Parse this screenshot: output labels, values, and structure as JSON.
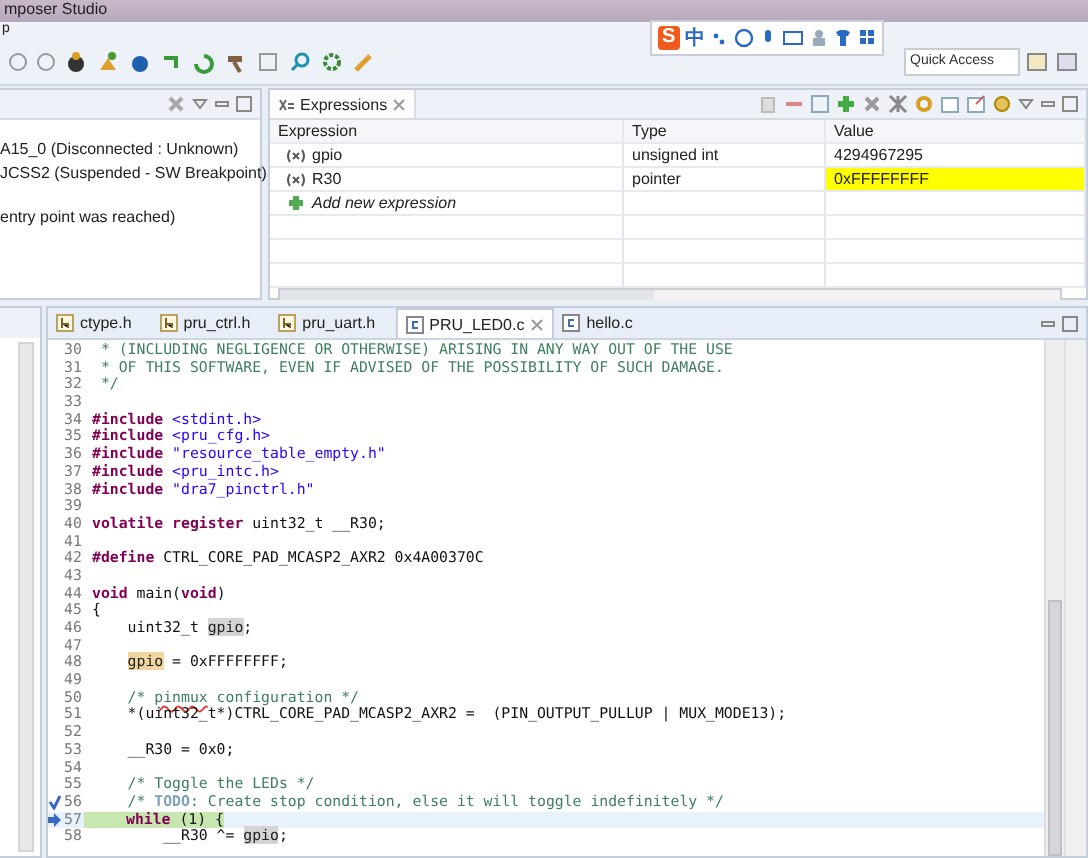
{
  "window": {
    "title": "mposer Studio"
  },
  "menu_bar": {
    "items": [
      "p"
    ]
  },
  "ime_toolbar": {
    "logo": "S",
    "mode": "中"
  },
  "quick_access": {
    "placeholder": "Quick Access"
  },
  "debug_panel": {
    "items": [
      {
        "text": "A15_0 (Disconnected : Unknown)"
      },
      {
        "text": "JCSS2 (Suspended - SW Breakpoint)"
      },
      {
        "text": "entry point was reached)"
      }
    ]
  },
  "expressions": {
    "tab": "Expressions",
    "columns": [
      "Expression",
      "Type",
      "Value"
    ],
    "rows": [
      {
        "name": "gpio",
        "type": "unsigned int",
        "value": "4294967295",
        "changed": false
      },
      {
        "name": "R30",
        "type": "pointer",
        "value": "0xFFFFFFFF",
        "changed": true
      }
    ],
    "add_row": "Add new expression"
  },
  "editor": {
    "tabs": [
      {
        "label": "ctype.h",
        "kind": "header",
        "selected": false
      },
      {
        "label": "pru_ctrl.h",
        "kind": "header",
        "selected": false
      },
      {
        "label": "pru_uart.h",
        "kind": "header",
        "selected": false
      },
      {
        "label": "PRU_LED0.c",
        "kind": "source",
        "selected": true
      },
      {
        "label": "hello.c",
        "kind": "source",
        "selected": false
      }
    ],
    "lines": [
      {
        "num": "30",
        "tokens": [
          {
            "kind": "comment",
            "text": " * (INCLUDING NEGLIGENCE OR OTHERWISE) ARISING IN ANY WAY OUT OF THE USE"
          }
        ]
      },
      {
        "num": "31",
        "tokens": [
          {
            "kind": "comment",
            "text": " * OF THIS SOFTWARE, EVEN IF ADVISED OF THE POSSIBILITY OF SUCH DAMAGE."
          }
        ]
      },
      {
        "num": "32",
        "tokens": [
          {
            "kind": "comment",
            "text": " */"
          }
        ]
      },
      {
        "num": "33"
      },
      {
        "num": "34",
        "tokens": [
          {
            "kind": "keyword",
            "text": "#include"
          },
          {
            "kind": "string",
            "text": " <stdint.h>"
          }
        ]
      },
      {
        "num": "35",
        "tokens": [
          {
            "kind": "keyword",
            "text": "#include"
          },
          {
            "kind": "string",
            "text": " <pru_cfg.h>"
          }
        ]
      },
      {
        "num": "36",
        "tokens": [
          {
            "kind": "keyword",
            "text": "#include"
          },
          {
            "kind": "string",
            "text": " \"resource_table_empty.h\""
          }
        ]
      },
      {
        "num": "37",
        "tokens": [
          {
            "kind": "keyword",
            "text": "#include"
          },
          {
            "kind": "string",
            "text": " <pru_intc.h>"
          }
        ]
      },
      {
        "num": "38",
        "tokens": [
          {
            "kind": "keyword",
            "text": "#include"
          },
          {
            "kind": "string",
            "text": " \"dra7_pinctrl.h\""
          }
        ]
      },
      {
        "num": "39"
      },
      {
        "num": "40",
        "tokens": [
          {
            "kind": "keyword",
            "text": "volatile register"
          },
          {
            "kind": "plain",
            "text": " uint32_t __R30;"
          }
        ]
      },
      {
        "num": "41"
      },
      {
        "num": "42",
        "tokens": [
          {
            "kind": "keyword",
            "text": "#define"
          },
          {
            "kind": "plain",
            "text": " CTRL_CORE_PAD_MCASP2_AXR2 0x4A00370C"
          }
        ]
      },
      {
        "num": "43"
      },
      {
        "num": "44",
        "tokens": [
          {
            "kind": "keyword",
            "text": "void"
          },
          {
            "kind": "plain",
            "text": " main("
          },
          {
            "kind": "keyword",
            "text": "void"
          },
          {
            "kind": "plain",
            "text": ")"
          }
        ]
      },
      {
        "num": "45",
        "tokens": [
          {
            "kind": "plain",
            "text": "{"
          }
        ]
      },
      {
        "num": "46",
        "tokens": [
          {
            "kind": "plain",
            "text": "    uint32_t "
          },
          {
            "kind": "occurrence",
            "text": "gpio"
          },
          {
            "kind": "plain",
            "text": ";"
          }
        ]
      },
      {
        "num": "47"
      },
      {
        "num": "48",
        "indented": true,
        "tokens": [
          {
            "kind": "write",
            "text": "gpio"
          },
          {
            "kind": "plain",
            "text": " = 0xFFFFFFFF;"
          }
        ]
      },
      {
        "num": "49"
      },
      {
        "num": "50",
        "tokens": [
          {
            "kind": "comment",
            "text": "    /* "
          },
          {
            "kind": "misspelled",
            "text": "pinmux"
          },
          {
            "kind": "comment",
            "text": " configuration */"
          }
        ]
      },
      {
        "num": "51",
        "tokens": [
          {
            "kind": "plain",
            "text": "    *(uint32_t*)CTRL_CORE_PAD_MCASP2_AXR2 =  (PIN_OUTPUT_PULLUP | MUX_MODE13);"
          }
        ]
      },
      {
        "num": "52"
      },
      {
        "num": "53",
        "tokens": [
          {
            "kind": "plain",
            "text": "    __R30 = 0x0;"
          }
        ]
      },
      {
        "num": "54"
      },
      {
        "num": "55",
        "tokens": [
          {
            "kind": "comment",
            "text": "    /* Toggle the LEDs */"
          }
        ]
      },
      {
        "num": "56",
        "task_marker": true,
        "tokens": [
          {
            "kind": "comment",
            "text": "    /* "
          },
          {
            "kind": "task",
            "text": "TODO"
          },
          {
            "kind": "comment",
            "text": ": Create stop condition, else it will toggle indefinitely */"
          }
        ]
      },
      {
        "num": "57",
        "pc_marker": true,
        "current": true,
        "indented": true,
        "tokens": [
          {
            "kind": "keyword",
            "text": "while"
          },
          {
            "kind": "plain",
            "text": " (1) {"
          }
        ]
      },
      {
        "num": "58",
        "tokens": [
          {
            "kind": "plain",
            "text": "        __R30 ^= "
          },
          {
            "kind": "occurrence",
            "text": "gpio"
          },
          {
            "kind": "plain",
            "text": ";"
          }
        ]
      }
    ]
  }
}
